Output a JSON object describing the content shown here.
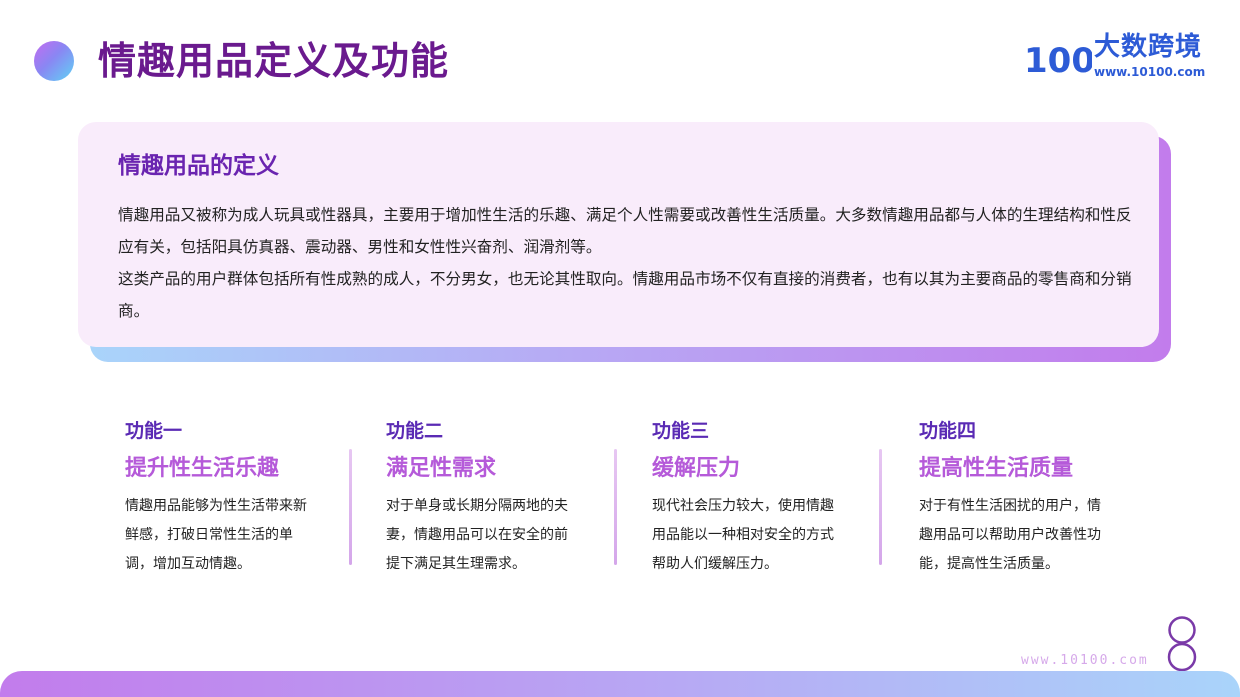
{
  "header": {
    "title": "情趣用品定义及功能"
  },
  "logo": {
    "mark_text": "100",
    "name": "大数跨境",
    "url": "www.10100.com"
  },
  "definition": {
    "title": "情趣用品的定义",
    "paragraphs": [
      "情趣用品又被称为成人玩具或性器具，主要用于增加性生活的乐趣、满足个人性需要或改善性生活质量。大多数情趣用品都与人体的生理结构和性反应有关，包括阳具仿真器、震动器、男性和女性性兴奋剂、润滑剂等。",
      "这类产品的用户群体包括所有性成熟的成人，不分男女，也无论其性取向。情趣用品市场不仅有直接的消费者，也有以其为主要商品的零售商和分销商。"
    ]
  },
  "functions": [
    {
      "label": "功能一",
      "title": "提升性生活乐趣",
      "desc": "情趣用品能够为性生活带来新鲜感，打破日常性生活的单调，增加互动情趣。"
    },
    {
      "label": "功能二",
      "title": "满足性需求",
      "desc": "对于单身或长期分隔两地的夫妻，情趣用品可以在安全的前提下满足其生理需求。"
    },
    {
      "label": "功能三",
      "title": "缓解压力",
      "desc": "现代社会压力较大，使用情趣用品能以一种相对安全的方式帮助人们缓解压力。"
    },
    {
      "label": "功能四",
      "title": "提高性生活质量",
      "desc": "对于有性生活困扰的用户，情趣用品可以帮助用户改善性功能，提高性生活质量。"
    }
  ],
  "footer": {
    "url": "www.10100.com"
  },
  "colors": {
    "title": "#6a1a8e",
    "accent_purple": "#5a2ab4",
    "accent_pink": "#b55ad9",
    "card_bg": "#f9ecfb",
    "logo_blue": "#2d5bd6"
  }
}
